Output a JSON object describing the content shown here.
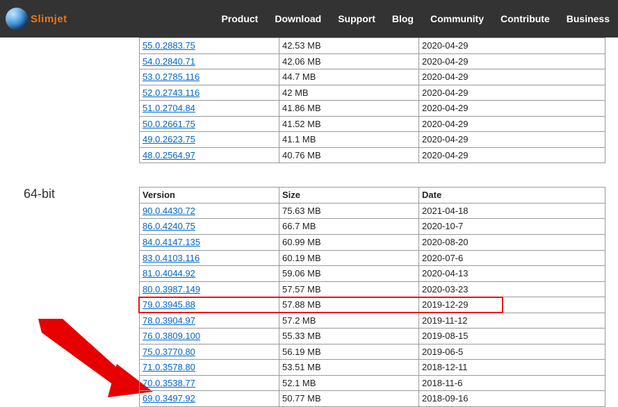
{
  "brand": {
    "name": "Slimjet"
  },
  "nav": {
    "items": [
      {
        "label": "Product"
      },
      {
        "label": "Download"
      },
      {
        "label": "Support"
      },
      {
        "label": "Blog"
      },
      {
        "label": "Community"
      },
      {
        "label": "Contribute"
      },
      {
        "label": "Business"
      }
    ]
  },
  "top_table": {
    "rows": [
      {
        "version": "55.0.2883.75",
        "size": "42.53 MB",
        "date": "2020-04-29"
      },
      {
        "version": "54.0.2840.71",
        "size": "42.06 MB",
        "date": "2020-04-29"
      },
      {
        "version": "53.0.2785.116",
        "size": "44.7 MB",
        "date": "2020-04-29"
      },
      {
        "version": "52.0.2743.116",
        "size": "42 MB",
        "date": "2020-04-29"
      },
      {
        "version": "51.0.2704.84",
        "size": "41.86 MB",
        "date": "2020-04-29"
      },
      {
        "version": "50.0.2661.75",
        "size": "41.52 MB",
        "date": "2020-04-29"
      },
      {
        "version": "49.0.2623.75",
        "size": "41.1 MB",
        "date": "2020-04-29"
      },
      {
        "version": "48.0.2564.97",
        "size": "40.76 MB",
        "date": "2020-04-29"
      }
    ]
  },
  "section": {
    "heading": "64-bit"
  },
  "main_table": {
    "headers": {
      "version": "Version",
      "size": "Size",
      "date": "Date"
    },
    "rows": [
      {
        "version": "90.0.4430.72",
        "size": "75.63 MB",
        "date": "2021-04-18"
      },
      {
        "version": "86.0.4240.75",
        "size": "66.7 MB",
        "date": "2020-10-7"
      },
      {
        "version": "84.0.4147.135",
        "size": "60.99 MB",
        "date": "2020-08-20"
      },
      {
        "version": "83.0.4103.116",
        "size": "60.19 MB",
        "date": "2020-07-6"
      },
      {
        "version": "81.0.4044.92",
        "size": "59.06 MB",
        "date": "2020-04-13"
      },
      {
        "version": "80.0.3987.149",
        "size": "57.57 MB",
        "date": "2020-03-23"
      },
      {
        "version": "79.0.3945.88",
        "size": "57.88 MB",
        "date": "2019-12-29",
        "highlight": true
      },
      {
        "version": "78.0.3904.97",
        "size": "57.2 MB",
        "date": "2019-11-12"
      },
      {
        "version": "76.0.3809.100",
        "size": "55.33 MB",
        "date": "2019-08-15"
      },
      {
        "version": "75.0.3770.80",
        "size": "56.19 MB",
        "date": "2019-06-5"
      },
      {
        "version": "71.0.3578.80",
        "size": "53.51 MB",
        "date": "2018-12-11"
      },
      {
        "version": "70.0.3538.77",
        "size": "52.1 MB",
        "date": "2018-11-6"
      },
      {
        "version": "69.0.3497.92",
        "size": "50.77 MB",
        "date": "2018-09-16"
      }
    ]
  }
}
